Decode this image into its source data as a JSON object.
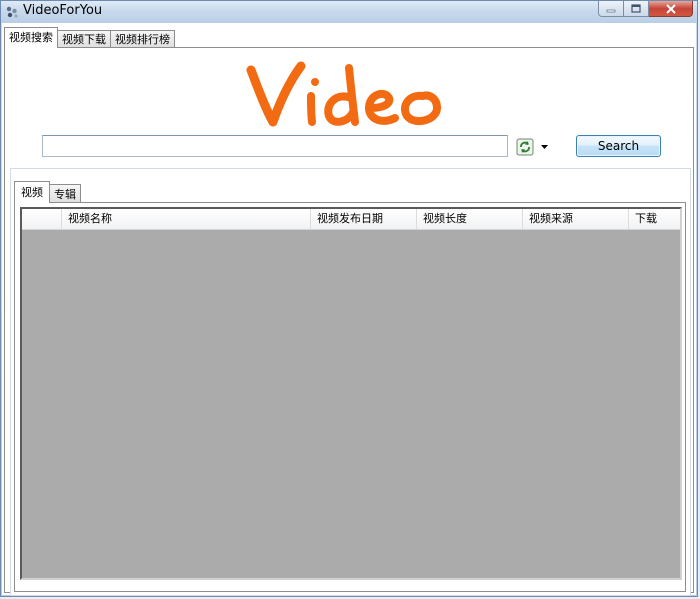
{
  "window": {
    "title": "VideoForYou"
  },
  "top_tabs": [
    {
      "label": "视频搜索",
      "active": true
    },
    {
      "label": "视频下载",
      "active": false
    },
    {
      "label": "视频排行榜",
      "active": false
    }
  ],
  "logo": {
    "text": "Video",
    "color": "#f26a12"
  },
  "search": {
    "value": "",
    "placeholder": "",
    "button_label": "Search"
  },
  "result_tabs": [
    {
      "label": "视频",
      "active": true
    },
    {
      "label": "专辑",
      "active": false
    }
  ],
  "grid": {
    "columns": [
      "",
      "视频名称",
      "视频发布日期",
      "视频长度",
      "视频来源",
      "下载"
    ],
    "rows": [],
    "background": "#ababab"
  },
  "icons": {
    "app": "app-icon",
    "minimize": "minimize-icon",
    "maximize": "maximize-icon",
    "close": "close-icon",
    "refresh": "refresh-icon",
    "dropdown": "chevron-down-icon"
  }
}
